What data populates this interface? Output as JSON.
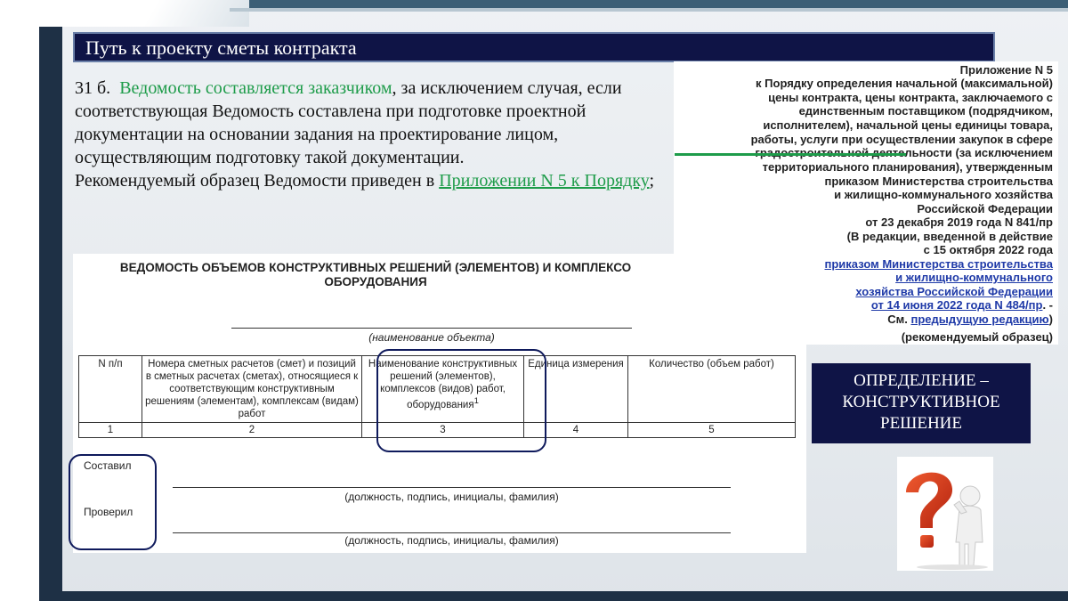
{
  "header": {
    "title": "Путь к проекту сметы контракта"
  },
  "body": {
    "clause_number": "31 б.",
    "highlight_phrase": "Ведомость составляется заказчиком",
    "paragraph_rest": ", за исключением случая, если соответствующая Ведомость составлена при подготовке проектной документации на основании задания на проектирование лицом, осуществляющим подготовку такой документации.",
    "recommended_prefix": "Рекомендуемый образец Ведомости приведен в ",
    "recommended_link": "Приложении N 5 к Порядку",
    "recommended_suffix": ";"
  },
  "statement": {
    "title_line1": "ВЕДОМОСТЬ ОБЪЕМОВ КОНСТРУКТИВНЫХ РЕШЕНИЙ (ЭЛЕМЕНТОВ) И КОМПЛЕКСО",
    "title_line2": "ОБОРУДОВАНИЯ",
    "object_caption": "(наименование объекта)",
    "columns": [
      "N п/п",
      "Номера сметных расчетов (смет) и позиций в сметных расчетах (сметах), относящиеся к соответствующим конструктивным решениям (элементам), комплексам (видам) работ",
      "Наименование конструктивных решений (элементов), комплексов (видов) работ, оборудования",
      "Единица измерения",
      "Количество (объем работ)"
    ],
    "footnote_mark": "1",
    "column_numbers": [
      "1",
      "2",
      "3",
      "4",
      "5"
    ],
    "compiled_label": "Составил",
    "checked_label": "Проверил",
    "signature_caption": "(должность, подпись, инициалы, фамилия)"
  },
  "appendix": {
    "lines": [
      "Приложение N 5",
      "к Порядку определения начальной (максимальной)",
      "цены контракта, цены контракта, заключаемого с",
      "единственным поставщиком (подрядчиком,",
      "исполнителем), начальной цены единицы товара,",
      "работы, услуги при осуществлении закупок в сфере",
      "градостроительной деятельности (за исключением",
      "территориального планирования), утвержденным",
      "приказом Министерства строительства",
      "и жилищно-коммунального хозяйства",
      "Российской Федерации",
      "от 23 декабря 2019 года N 841/пр",
      "(В редакции, введенной в действие",
      "с 15 октября 2022 года"
    ],
    "link_lines": [
      "приказом Министерства строительства",
      "и жилищно-коммунального",
      "хозяйства Российской Федерации",
      "от 14 июня 2022 года N 484/пр"
    ],
    "after_link": ". -",
    "see_prefix": "См. ",
    "see_link": "предыдущую редакцию",
    "see_suffix": ")",
    "sample_note": "(рекомендуемый образец)"
  },
  "definition_box": {
    "line1": "ОПРЕДЕЛЕНИЕ –",
    "line2": "КОНСТРУКТИВНОЕ",
    "line3": "РЕШЕНИЕ"
  },
  "colors": {
    "title_bar": "#0f1446",
    "accent_green": "#1e9c4a",
    "link_blue": "#1f3aa8",
    "dark_navy": "#1e3045",
    "question_red": "#d83a1e"
  },
  "figure": {
    "icon": "question-mark-person-icon"
  }
}
